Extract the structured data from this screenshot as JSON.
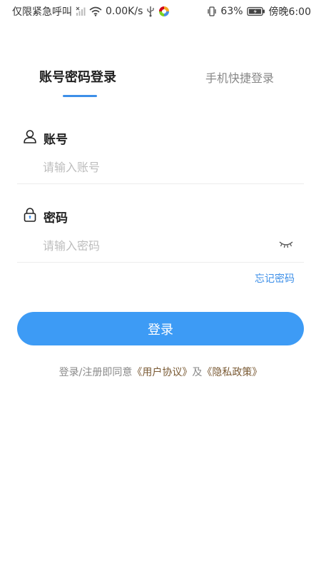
{
  "status_bar": {
    "left_text": "仅限紧急呼叫",
    "speed": "0.00K/s",
    "battery": "63%",
    "time": "傍晚6:00",
    "icons": [
      "signal-icon",
      "wifi-icon",
      "usb-icon",
      "app-icon",
      "vibrate-icon",
      "battery-icon"
    ]
  },
  "tabs": [
    {
      "label": "账号密码登录",
      "active": true
    },
    {
      "label": "手机快捷登录",
      "active": false
    }
  ],
  "account": {
    "label": "账号",
    "placeholder": "请输入账号",
    "value": ""
  },
  "password": {
    "label": "密码",
    "placeholder": "请输入密码",
    "value": ""
  },
  "forgot_label": "忘记密码",
  "login_label": "登录",
  "agreement": {
    "prefix": "登录/注册即同意",
    "user_agreement": "《用户协议》",
    "connector": "及",
    "privacy_policy": "《隐私政策》"
  },
  "colors": {
    "accent": "#3d9bf5",
    "link": "#3d8fe8",
    "agreement_link": "#7a5a34"
  }
}
